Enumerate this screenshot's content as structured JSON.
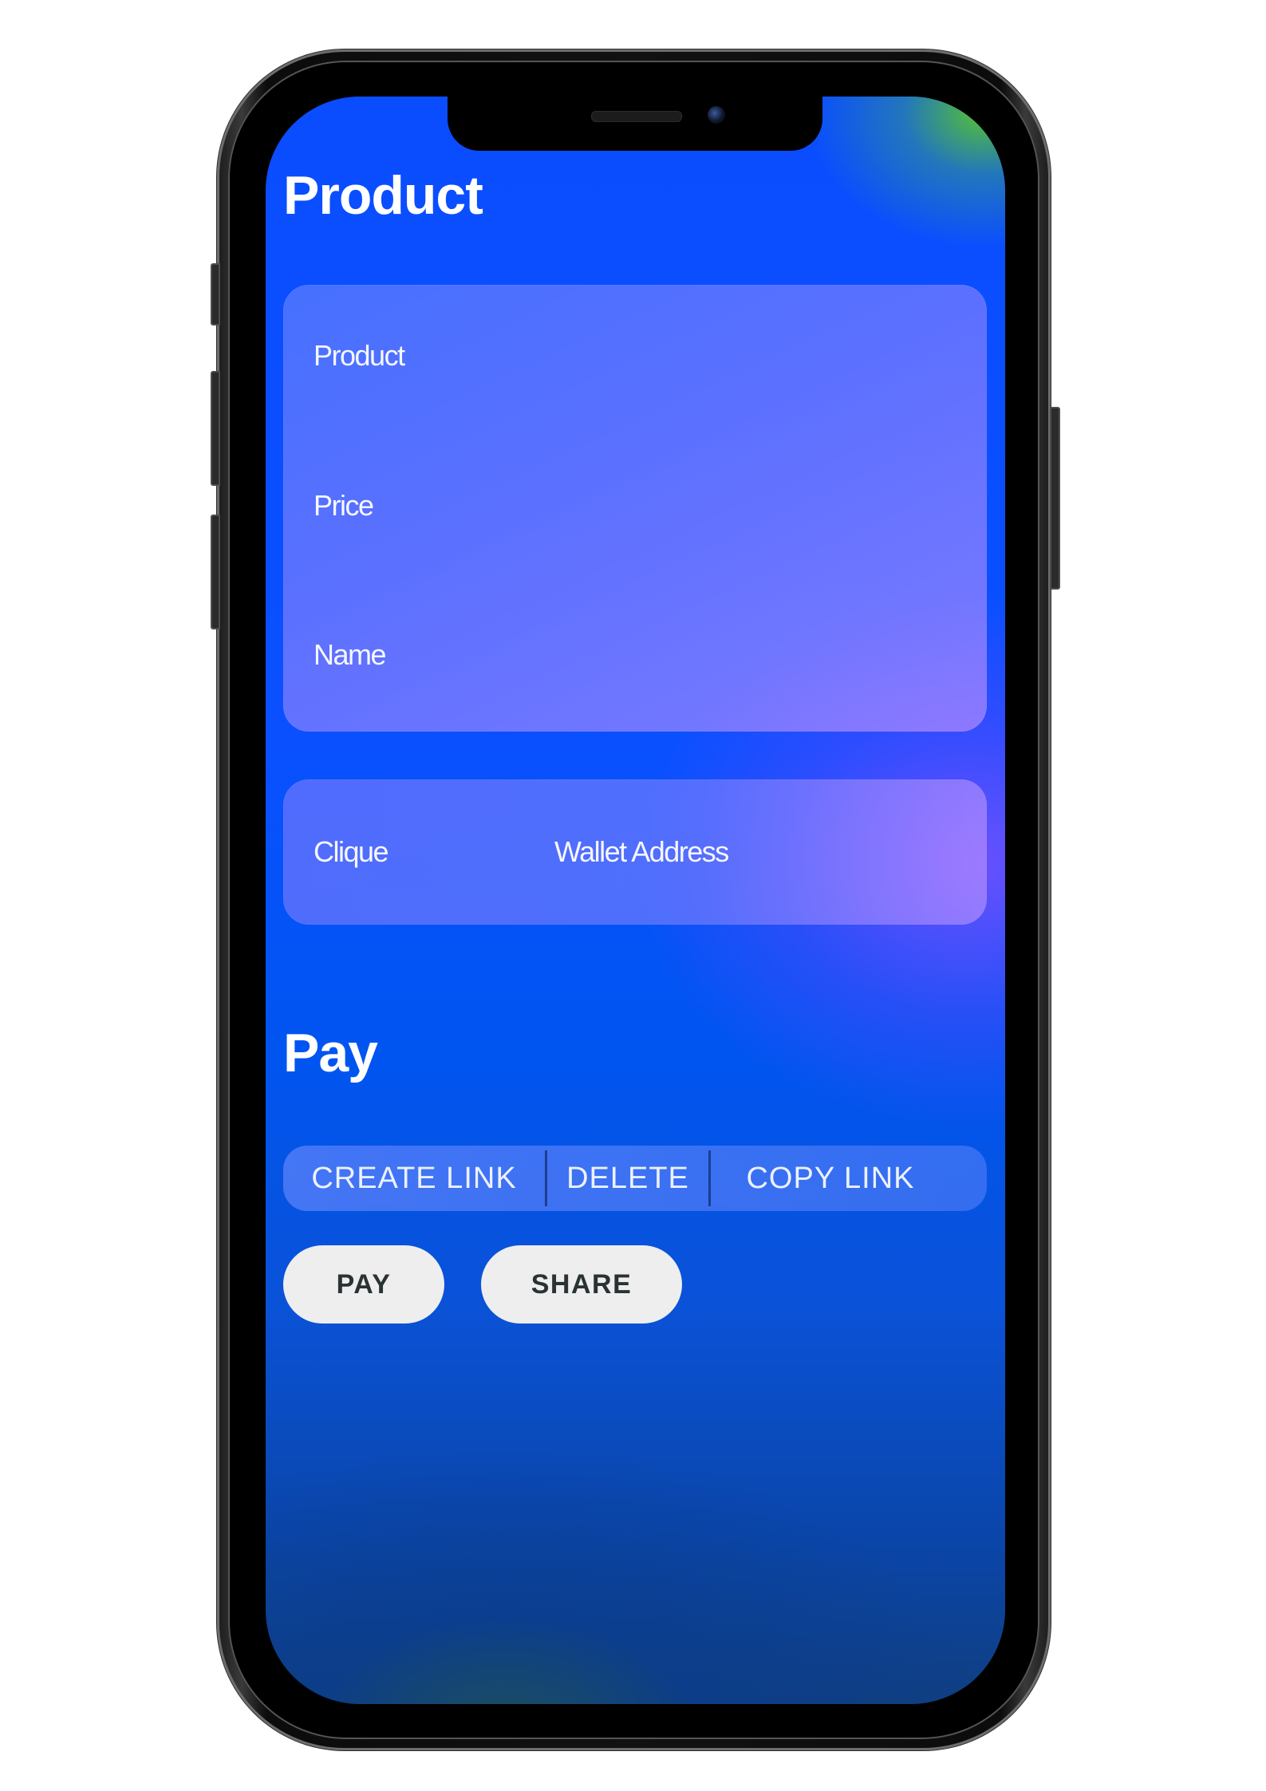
{
  "product_section": {
    "title": "Product",
    "form": {
      "product_label": "Product",
      "price_label": "Price",
      "name_label": "Name"
    },
    "wallet": {
      "clique_label": "Clique",
      "wallet_label": "Wallet Address"
    }
  },
  "pay_section": {
    "title": "Pay",
    "segmented": {
      "create_link": "CREATE LINK",
      "delete": "DELETE",
      "copy_link": "COPY LINK"
    },
    "buttons": {
      "pay": "PAY",
      "share": "SHARE"
    }
  },
  "colors": {
    "screen_primary": "#0a50ff",
    "card_tint": "#b08cff",
    "pill_background": "#eeeeee",
    "pill_text": "#2a3333"
  }
}
